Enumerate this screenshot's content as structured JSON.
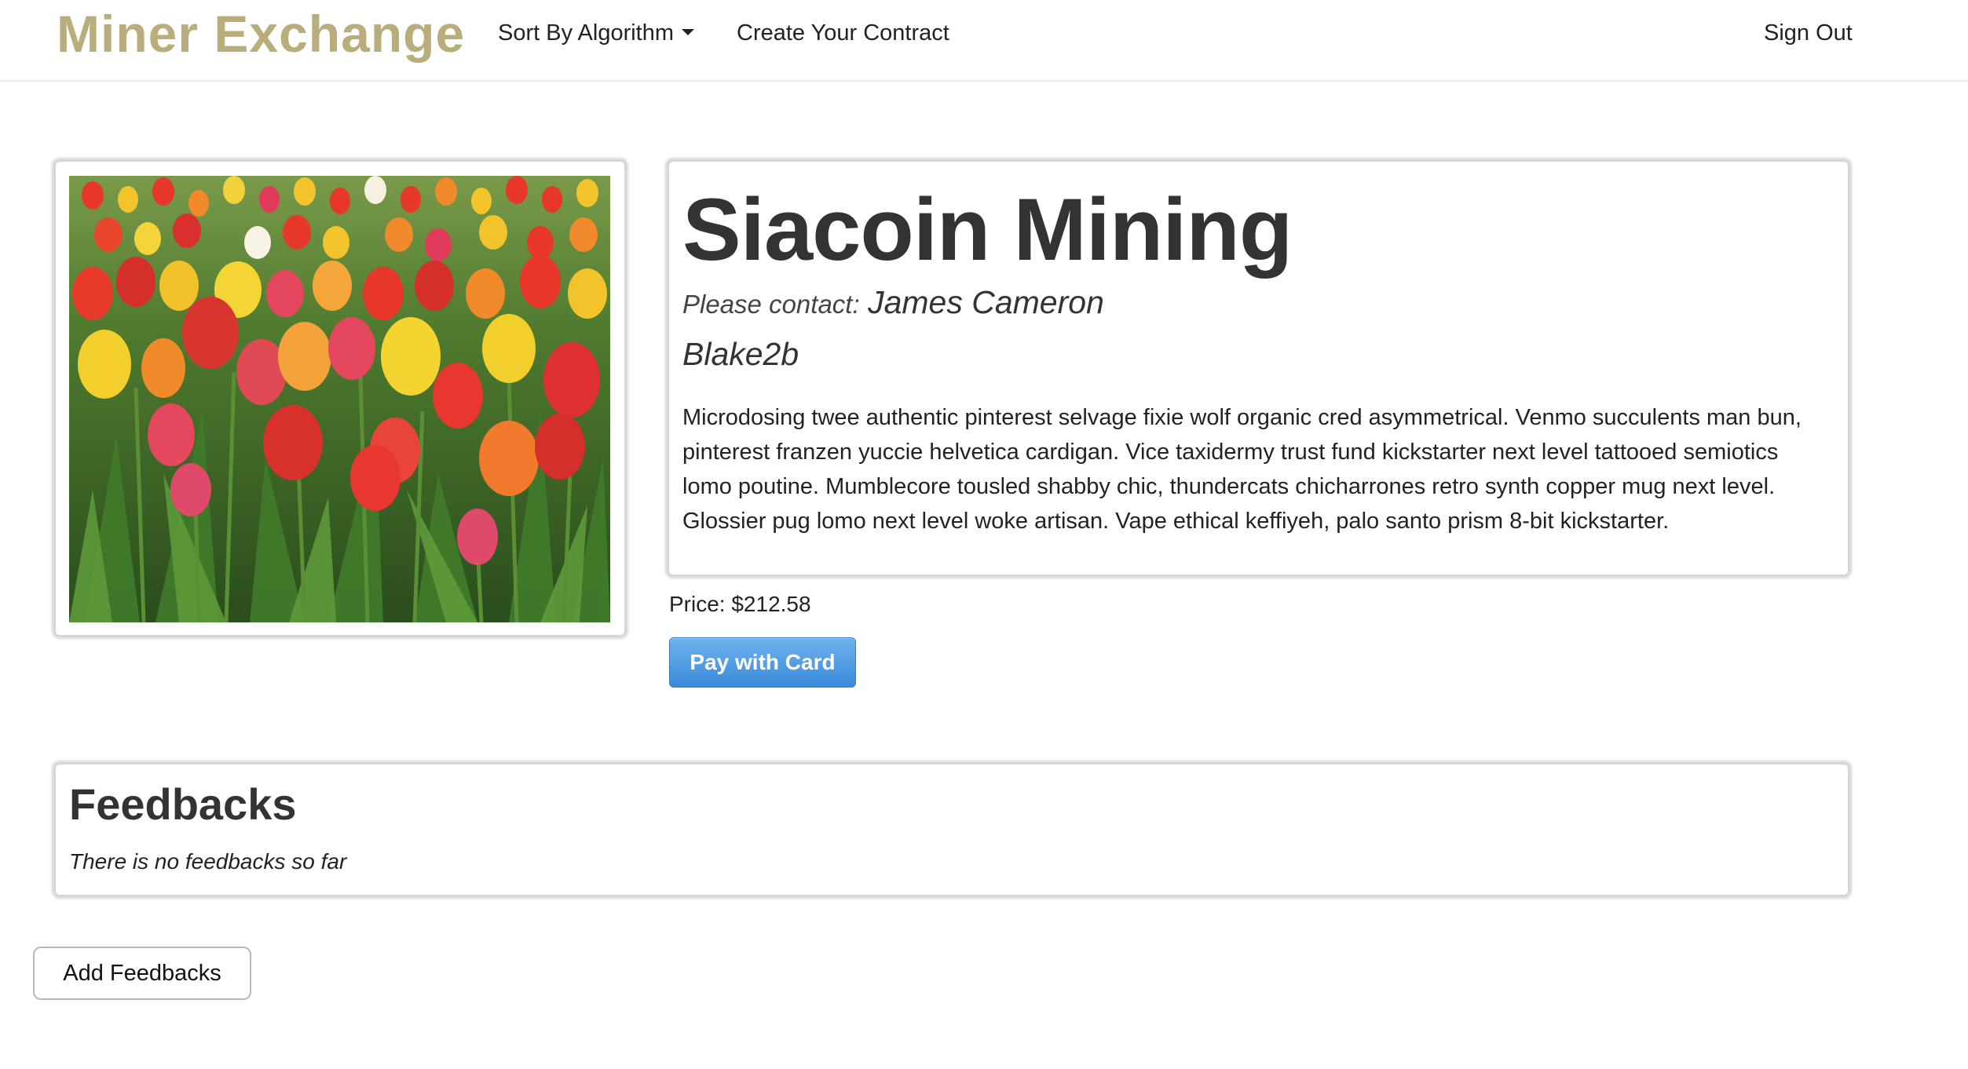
{
  "navbar": {
    "brand": "Miner Exchange",
    "sort_label": "Sort By Algorithm",
    "create_label": "Create Your Contract",
    "signout_label": "Sign Out"
  },
  "contract": {
    "title": "Siacoin Mining",
    "contact_label": "Please contact:",
    "contact_name": "James Cameron",
    "algorithm": "Blake2b",
    "description": "Microdosing twee authentic pinterest selvage fixie wolf organic cred asymmetrical. Venmo succulents man bun, pinterest franzen yuccie helvetica cardigan. Vice taxidermy trust fund kickstarter next level tattooed semiotics lomo poutine. Mumblecore tousled shabby chic, thundercats chicharrones retro synth copper mug next level. Glossier pug lomo next level woke artisan. Vape ethical keffiyeh, palo santo prism 8-bit kickstarter.",
    "price": "Price: $212.58",
    "pay_label": "Pay with Card"
  },
  "feedbacks": {
    "title": "Feedbacks",
    "empty_text": "There is no feedbacks so far",
    "add_label": "Add Feedbacks"
  },
  "colors": {
    "brand": "#b9ad7b",
    "pay_button": "#4a96df",
    "text": "#333333"
  },
  "icons": {
    "sort_dropdown": "caret-down-icon"
  }
}
